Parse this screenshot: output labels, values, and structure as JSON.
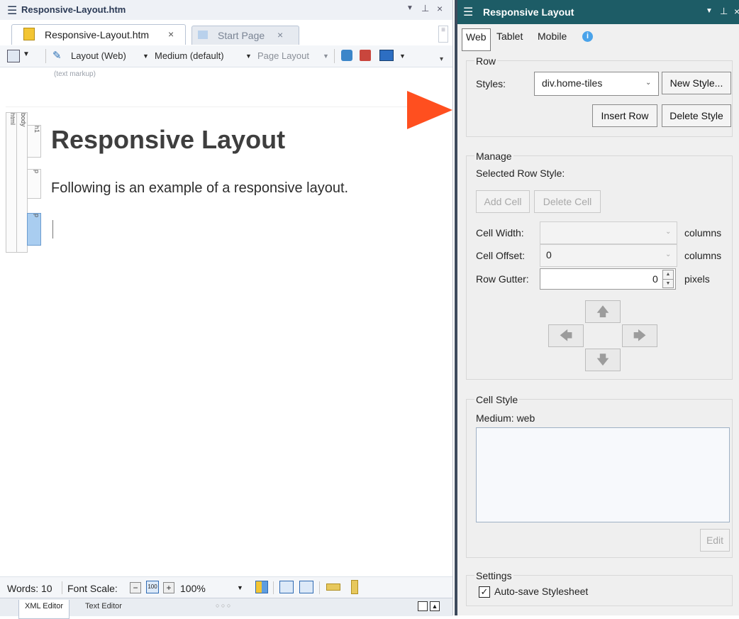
{
  "doc": {
    "window_title": "Responsive-Layout.htm",
    "tabs": [
      {
        "label": "Responsive-Layout.htm",
        "close": "×"
      },
      {
        "label": "Start Page",
        "close": "×"
      }
    ],
    "toolbar": {
      "layout": "Layout (Web)",
      "medium": "Medium (default)",
      "page_layout": "Page Layout"
    },
    "hint": "(text markup)",
    "structure_tags": [
      "html",
      "body",
      "h1",
      "p",
      "p"
    ],
    "heading": "Responsive Layout",
    "paragraph": "Following is an example of a responsive layout.",
    "status": {
      "words": "Words: 10",
      "font_scale_label": "Font Scale:",
      "zoom": "100%"
    },
    "bottom_tabs": [
      "XML Editor",
      "Text Editor"
    ],
    "bottom_dots": "○ ○ ○"
  },
  "panel": {
    "title": "Responsive Layout",
    "medium_tabs": [
      "Web",
      "Tablet",
      "Mobile"
    ],
    "row": {
      "group_label": "Row",
      "styles_label": "Styles:",
      "styles_value": "div.home-tiles",
      "new_style": "New Style...",
      "insert_row": "Insert Row",
      "delete_style": "Delete Style"
    },
    "manage": {
      "group_label": "Manage",
      "selected_row_style": "Selected Row Style:",
      "add_cell": "Add Cell",
      "delete_cell": "Delete Cell",
      "cell_width_label": "Cell Width:",
      "cell_width_value": "",
      "cell_width_unit": "columns",
      "cell_offset_label": "Cell Offset:",
      "cell_offset_value": "0",
      "cell_offset_unit": "columns",
      "row_gutter_label": "Row Gutter:",
      "row_gutter_value": "0",
      "row_gutter_unit": "pixels"
    },
    "cell_style": {
      "group_label": "Cell Style",
      "medium": "Medium: web",
      "edit": "Edit"
    },
    "settings": {
      "group_label": "Settings",
      "autosave": "Auto-save Stylesheet",
      "autosave_checked": true
    }
  },
  "colors": {
    "panel_title_bg": "#1d5c66",
    "callout_arrow": "#ff4f1f"
  }
}
